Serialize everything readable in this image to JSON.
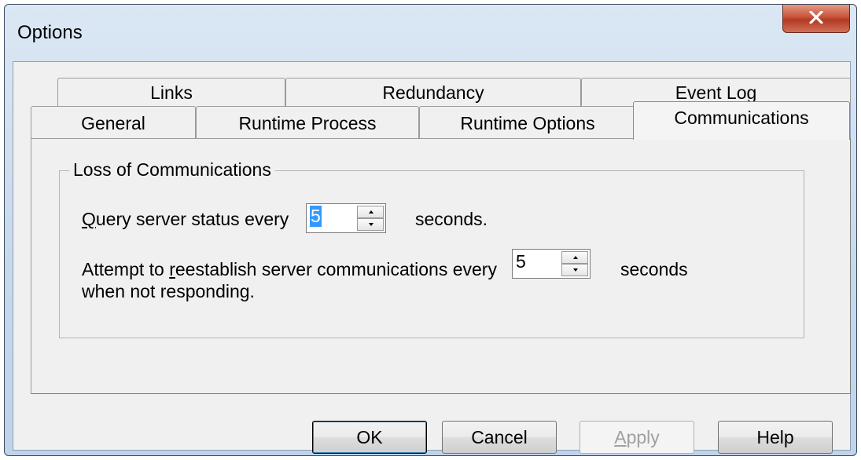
{
  "window": {
    "title": "Options"
  },
  "tabs": {
    "row1": [
      "Links",
      "Redundancy",
      "Event Log"
    ],
    "row2": [
      "General",
      "Runtime Process",
      "Runtime Options",
      "Communications"
    ],
    "active": "Communications"
  },
  "group": {
    "label": "Loss of Communications",
    "query_label": "Query server status every",
    "query_value": "5",
    "query_unit": "seconds.",
    "reestablish_label_line1": "Attempt to reestablish server communications every",
    "reestablish_label_line2": "when not responding.",
    "reestablish_value": "5",
    "reestablish_unit": "seconds"
  },
  "buttons": {
    "ok": "OK",
    "cancel": "Cancel",
    "apply": "Apply",
    "help": "Help"
  }
}
